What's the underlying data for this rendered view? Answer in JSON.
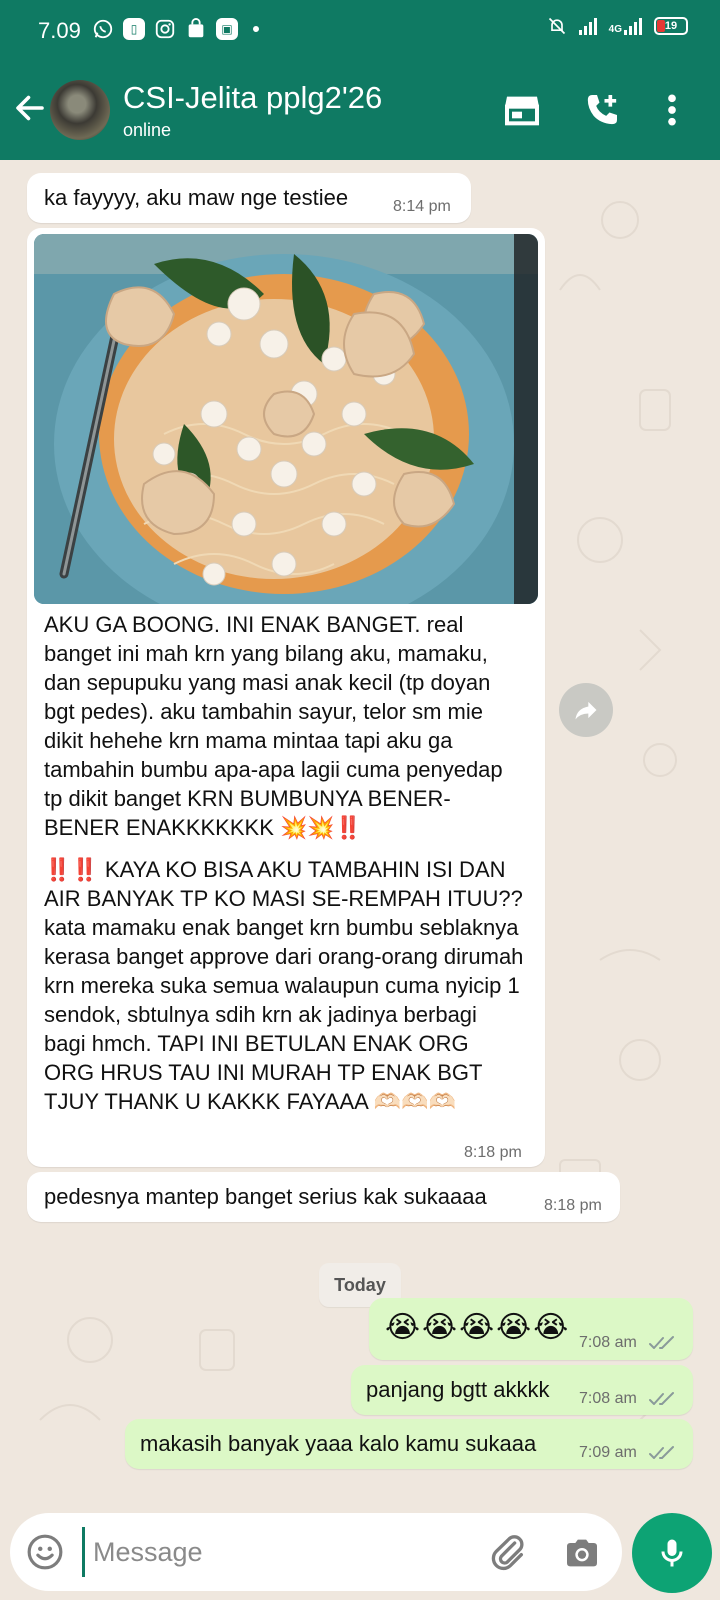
{
  "status_bar": {
    "time": "7.09",
    "network_label": "4G",
    "battery_level": "19"
  },
  "header": {
    "chat_name": "CSI-Jelita pplg2'26",
    "chat_status": "online"
  },
  "messages": [
    {
      "direction": "in",
      "text": "ka fayyyy, aku maw nge testiee",
      "time": "8:14 pm"
    },
    {
      "direction": "in",
      "has_photo": true,
      "text_p1": "AKU GA BOONG. INI ENAK BANGET. real banget ini mah krn yang bilang aku, mamaku, dan sepupuku yang masi anak kecil (tp doyan bgt pedes). aku tambahin sayur, telor sm mie dikit hehehe krn mama mintaa tapi aku ga tambahin bumbu apa-apa lagii cuma penyedap tp dikit banget KRN BUMBUNYA BENER-BENER ENAKKKKKKK 💥💥‼️",
      "text_p2": "‼️‼️ KAYA KO BISA AKU TAMBAHIN ISI DAN AIR BANYAK TP KO MASI SE-REMPAH ITUU?? kata mamaku enak banget krn bumbu seblaknya kerasa banget approve dari orang-orang dirumah krn mereka suka semua walaupun cuma nyicip 1 sendok, sbtulnya sdih krn ak jadinya berbagi bagi hmch. TAPI INI BETULAN ENAK ORG ORG HRUS TAU INI MURAH TP ENAK BGT TJUY THANK U KAKKK FAYAAA 🫶🏻🫶🏻🫶🏻",
      "time": "8:18 pm"
    },
    {
      "direction": "in",
      "text": "pedesnya mantep banget serius kak sukaaaa",
      "time": "8:18 pm"
    },
    {
      "direction": "out",
      "text": "😭😭😭😭😭",
      "time": "7:08 am"
    },
    {
      "direction": "out",
      "text": "panjang bgtt akkkk",
      "time": "7:08 am"
    },
    {
      "direction": "out",
      "text": "makasih banyak yaaa kalo kamu sukaaa",
      "time": "7:09 am"
    }
  ],
  "date_divider": "Today",
  "composer": {
    "placeholder": "Message"
  },
  "colors": {
    "header": "#0f7a63",
    "outgoing_bubble": "#dcf8c6",
    "incoming_bubble": "#ffffff",
    "chat_background": "#efe7de",
    "mic_button": "#0da374",
    "read_ticks": "#8a9a9a"
  },
  "icons": {
    "back": "arrow-left-icon",
    "shop": "storefront-icon",
    "call": "add-call-icon",
    "menu": "more-vert-icon",
    "forward": "forward-icon",
    "emoji": "emoji-icon",
    "attach": "paperclip-icon",
    "camera": "camera-icon",
    "mic": "mic-icon"
  }
}
